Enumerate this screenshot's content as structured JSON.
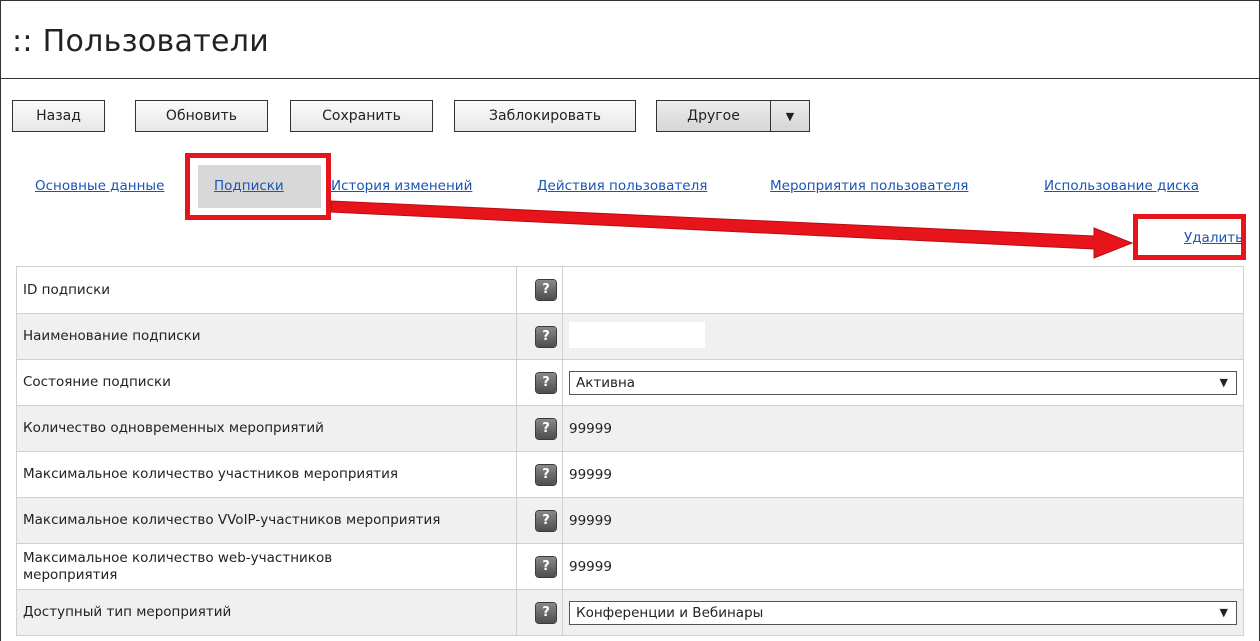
{
  "page": {
    "title": ":: Пользователи"
  },
  "toolbar": {
    "back": "Назад",
    "refresh": "Обновить",
    "save": "Сохранить",
    "block": "Заблокировать",
    "other": "Другое",
    "other_arrow": "▼"
  },
  "tabs": {
    "main": "Основные данные",
    "subscriptions": "Подписки",
    "history": "История изменений",
    "user_actions": "Действия пользователя",
    "user_events": "Мероприятия пользователя",
    "disk_usage": "Использование диска"
  },
  "actions": {
    "delete": "Удалить"
  },
  "help_glyph": "?",
  "rows": {
    "r0": {
      "label": "ID подписки",
      "value": ""
    },
    "r1": {
      "label": "Наименование подписки",
      "value": ""
    },
    "r2": {
      "label": "Состояние подписки",
      "value": "Активна"
    },
    "r3": {
      "label": "Количество одновременных мероприятий",
      "value": "99999"
    },
    "r4": {
      "label": "Максимальное количество участников мероприятия",
      "value": "99999"
    },
    "r5": {
      "label": "Максимальное количество VVoIP-участников мероприятия",
      "value": "99999"
    },
    "r6": {
      "label": "Максимальное количество web-участников мероприятия",
      "value": "99999"
    },
    "r7": {
      "label": "Доступный тип мероприятий",
      "value": "Конференции и Вебинары"
    }
  },
  "select_caret": "▼",
  "colors": {
    "link": "#1a55b5",
    "annotation_red": "#e8141c",
    "active_tab_bg": "#d8d8d8"
  }
}
